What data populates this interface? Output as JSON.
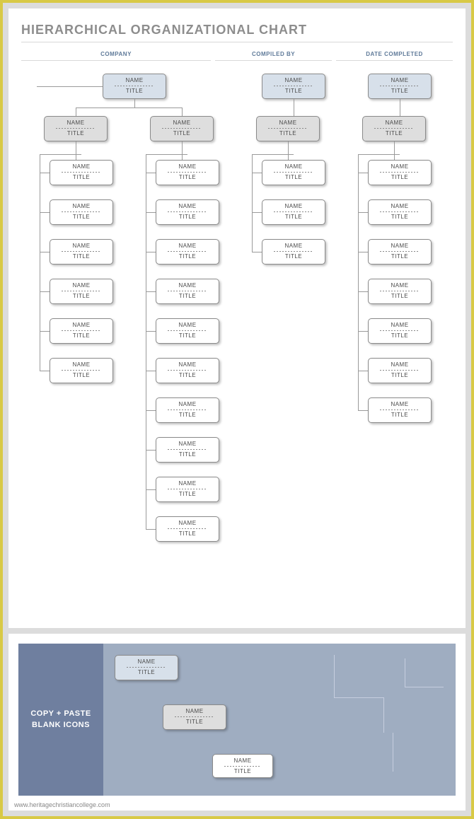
{
  "page1": {
    "title": "HIERARCHICAL ORGANIZATIONAL CHART",
    "headers": {
      "company": "COMPANY",
      "compiled_by": "COMPILED BY",
      "date_completed": "DATE COMPLETED"
    }
  },
  "labels": {
    "name": "NAME",
    "title": "TITLE"
  },
  "chart_data": {
    "type": "tree",
    "roots": [
      {
        "name": "NAME",
        "title": "TITLE",
        "style": "top-blue",
        "children": [
          {
            "name": "NAME",
            "title": "TITLE",
            "style": "mid-grey",
            "children": [
              {
                "name": "NAME",
                "title": "TITLE",
                "style": "leaf-white"
              },
              {
                "name": "NAME",
                "title": "TITLE",
                "style": "leaf-white"
              },
              {
                "name": "NAME",
                "title": "TITLE",
                "style": "leaf-white"
              },
              {
                "name": "NAME",
                "title": "TITLE",
                "style": "leaf-white"
              },
              {
                "name": "NAME",
                "title": "TITLE",
                "style": "leaf-white"
              },
              {
                "name": "NAME",
                "title": "TITLE",
                "style": "leaf-white"
              }
            ]
          },
          {
            "name": "NAME",
            "title": "TITLE",
            "style": "mid-grey",
            "children": [
              {
                "name": "NAME",
                "title": "TITLE",
                "style": "leaf-white"
              },
              {
                "name": "NAME",
                "title": "TITLE",
                "style": "leaf-white"
              },
              {
                "name": "NAME",
                "title": "TITLE",
                "style": "leaf-white"
              },
              {
                "name": "NAME",
                "title": "TITLE",
                "style": "leaf-white"
              },
              {
                "name": "NAME",
                "title": "TITLE",
                "style": "leaf-white"
              },
              {
                "name": "NAME",
                "title": "TITLE",
                "style": "leaf-white"
              },
              {
                "name": "NAME",
                "title": "TITLE",
                "style": "leaf-white"
              },
              {
                "name": "NAME",
                "title": "TITLE",
                "style": "leaf-white"
              },
              {
                "name": "NAME",
                "title": "TITLE",
                "style": "leaf-white"
              },
              {
                "name": "NAME",
                "title": "TITLE",
                "style": "leaf-white"
              }
            ]
          }
        ]
      },
      {
        "name": "NAME",
        "title": "TITLE",
        "style": "top-blue",
        "children": [
          {
            "name": "NAME",
            "title": "TITLE",
            "style": "mid-grey",
            "children": [
              {
                "name": "NAME",
                "title": "TITLE",
                "style": "leaf-white"
              },
              {
                "name": "NAME",
                "title": "TITLE",
                "style": "leaf-white"
              },
              {
                "name": "NAME",
                "title": "TITLE",
                "style": "leaf-white"
              }
            ]
          }
        ]
      },
      {
        "name": "NAME",
        "title": "TITLE",
        "style": "top-blue",
        "children": [
          {
            "name": "NAME",
            "title": "TITLE",
            "style": "mid-grey",
            "children": [
              {
                "name": "NAME",
                "title": "TITLE",
                "style": "leaf-white"
              },
              {
                "name": "NAME",
                "title": "TITLE",
                "style": "leaf-white"
              },
              {
                "name": "NAME",
                "title": "TITLE",
                "style": "leaf-white"
              },
              {
                "name": "NAME",
                "title": "TITLE",
                "style": "leaf-white"
              },
              {
                "name": "NAME",
                "title": "TITLE",
                "style": "leaf-white"
              },
              {
                "name": "NAME",
                "title": "TITLE",
                "style": "leaf-white"
              },
              {
                "name": "NAME",
                "title": "TITLE",
                "style": "leaf-white"
              }
            ]
          }
        ]
      }
    ]
  },
  "page2": {
    "left_band_1": "COPY + PASTE",
    "left_band_2": "BLANK ICONS",
    "samples": [
      {
        "name": "NAME",
        "title": "TITLE",
        "style": "top-blue"
      },
      {
        "name": "NAME",
        "title": "TITLE",
        "style": "mid-grey"
      },
      {
        "name": "NAME",
        "title": "TITLE",
        "style": "leaf-white"
      }
    ]
  },
  "source_url": "www.heritagechristiancollege.com"
}
